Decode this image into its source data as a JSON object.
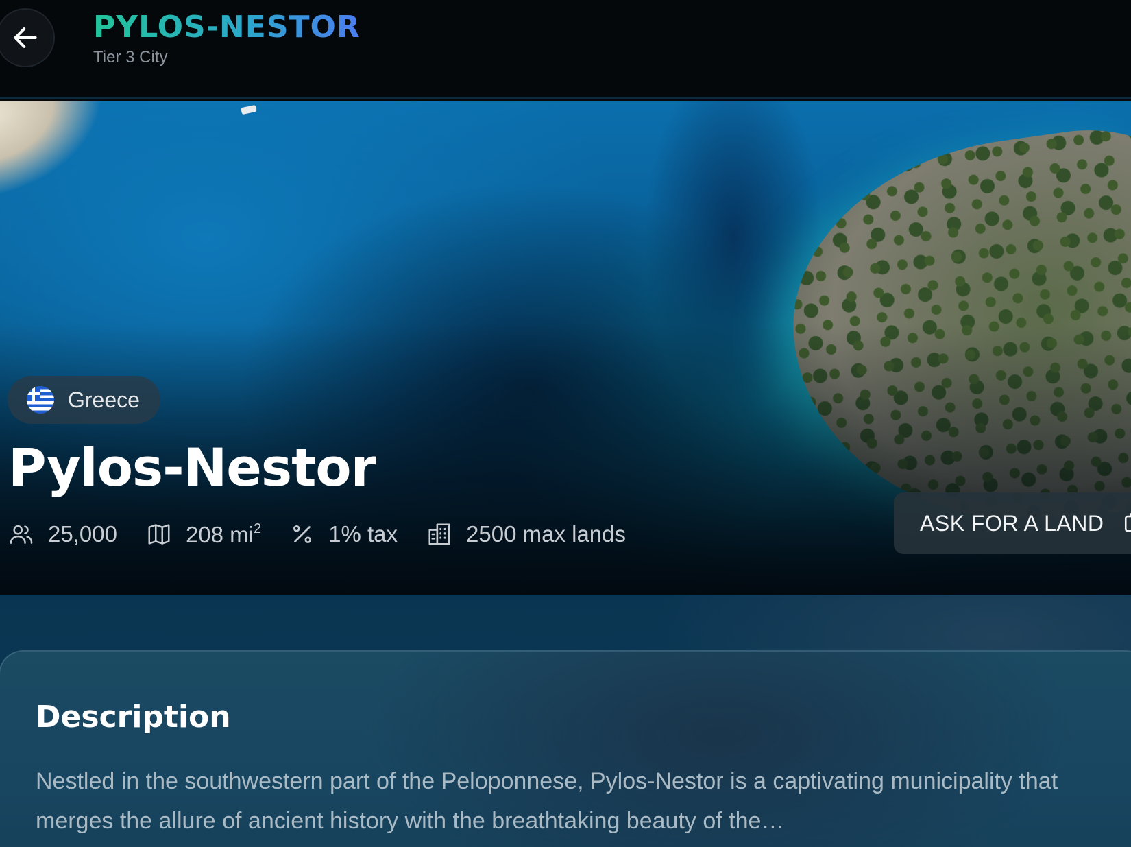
{
  "header": {
    "title": "PYLOS-NESTOR",
    "subtitle": "Tier 3 City",
    "back_icon": "arrow-left-icon"
  },
  "hero": {
    "country": "Greece",
    "country_flag_icon": "greece-flag-icon",
    "city_name": "Pylos-Nestor",
    "stats": {
      "population": "25,000",
      "area_value": "208 mi",
      "area_exponent": "2",
      "tax": "1% tax",
      "max_lands": "2500 max lands"
    },
    "ask_button_label": "ASK FOR A LAND"
  },
  "description": {
    "title": "Description",
    "text": "Nestled in the southwestern part of the Peloponnese, Pylos-Nestor is a captivating municipality that merges the allure of ancient history with the breathtaking beauty of the…"
  },
  "colors": {
    "title_gradient_start": "#22c49a",
    "title_gradient_end": "#4b7cf0",
    "background": "#05090d",
    "section_blue": "#0b3a56"
  }
}
